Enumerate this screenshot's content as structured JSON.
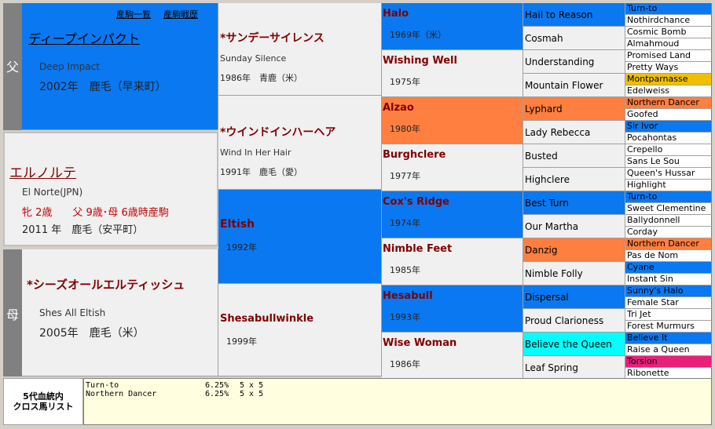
{
  "sire": {
    "side_label": "父",
    "links": [
      "産駒一覧",
      "産駒戦歴"
    ],
    "name_jp": "ディープインパクト",
    "name_en": "Deep Impact",
    "info": "2002年　鹿毛（早来町）"
  },
  "subject": {
    "name_jp": "エルノルテ",
    "name_en": "El Norte(JPN)",
    "sex_age": "牝 2歳　　父 9歳･母 6歳時産駒",
    "info": "2011 年　鹿毛（安平町）"
  },
  "dam": {
    "side_label": "母",
    "name_jp": "*シーズオールエルティッシュ",
    "name_en": "Shes All Eltish",
    "info": "2005年　鹿毛（米）"
  },
  "gen2": [
    {
      "name_jp": "*サンデーサイレンス",
      "name_en": "Sunday Silence",
      "info": "1986年　青鹿（米）"
    },
    {
      "name_jp": "*ウインドインハーヘア",
      "name_en": "Wind In Her Hair",
      "info": "1991年　鹿毛（愛）"
    },
    {
      "name": "Eltish",
      "info": "1992年"
    },
    {
      "name": "Shesabullwinkle",
      "info": "1999年"
    }
  ],
  "gen3": [
    {
      "name": "Halo",
      "info": "1969年（米）"
    },
    {
      "name": "Wishing Well",
      "info": "1975年"
    },
    {
      "name": "Alzao",
      "info": "1980年"
    },
    {
      "name": "Burghclere",
      "info": "1977年"
    },
    {
      "name": "Cox's Ridge",
      "info": "1974年"
    },
    {
      "name": "Nimble Feet",
      "info": "1985年"
    },
    {
      "name": "Hesabull",
      "info": "1993年"
    },
    {
      "name": "Wise Woman",
      "info": "1986年"
    }
  ],
  "gen4": [
    "Hail to Reason",
    "Cosmah",
    "Understanding",
    "Mountain Flower",
    "Lyphard",
    "Lady Rebecca",
    "Busted",
    "Highclere",
    "Best Turn",
    "Our Martha",
    "Danzig",
    "Nimble Folly",
    "Dispersal",
    "Proud Clarioness",
    "Believe the Queen",
    "Leaf Spring"
  ],
  "gen5": [
    "Turn-to",
    "Nothirdchance",
    "Cosmic Bomb",
    "Almahmoud",
    "Promised Land",
    "Pretty Ways",
    "Montparnasse",
    "Edelweiss",
    "Northern Dancer",
    "Goofed",
    "Sir Ivor",
    "Pocahontas",
    "Crepello",
    "Sans Le Sou",
    "Queen's Hussar",
    "Highlight",
    "Turn-to",
    "Sweet Clementine",
    "Ballydonnell",
    "Corday",
    "Northern Dancer",
    "Pas de Nom",
    "Cyane",
    "Instant Sin",
    "Sunny's Halo",
    "Female Star",
    "Tri Jet",
    "Forest Murmurs",
    "Believe It",
    "Raise a Queen",
    "Torsion",
    "Ribonette"
  ],
  "cross": {
    "label": "5代血統内\nクロス馬リスト",
    "rows": [
      {
        "name": "Turn-to",
        "pct": "6.25%",
        "gen": "5 x 5"
      },
      {
        "name": "Northern Dancer",
        "pct": "6.25%",
        "gen": "5 x 5"
      }
    ]
  },
  "colors": {
    "blue": "#0a78f0",
    "light": "#f0f0f0",
    "orange": "#ff7f40",
    "yellow": "#f0c000",
    "cyan": "#00ffff",
    "magenta": "#e8207a",
    "jp_text": "#800000",
    "cross_bg": "#ffffe0"
  },
  "highlights": {
    "gen3_blue": [
      0,
      4,
      6
    ],
    "gen3_orange": [
      2
    ],
    "gen2_blue": [
      2
    ],
    "gen4_blue": [
      0,
      8,
      12
    ],
    "gen4_orange": [
      4,
      10
    ],
    "gen4_cyan": [
      14
    ],
    "gen5_blue": [
      0,
      10,
      16,
      22,
      24,
      28
    ],
    "gen5_orange": [
      8,
      20
    ],
    "gen5_yellow": [
      6
    ],
    "gen5_magenta": [
      30
    ]
  }
}
